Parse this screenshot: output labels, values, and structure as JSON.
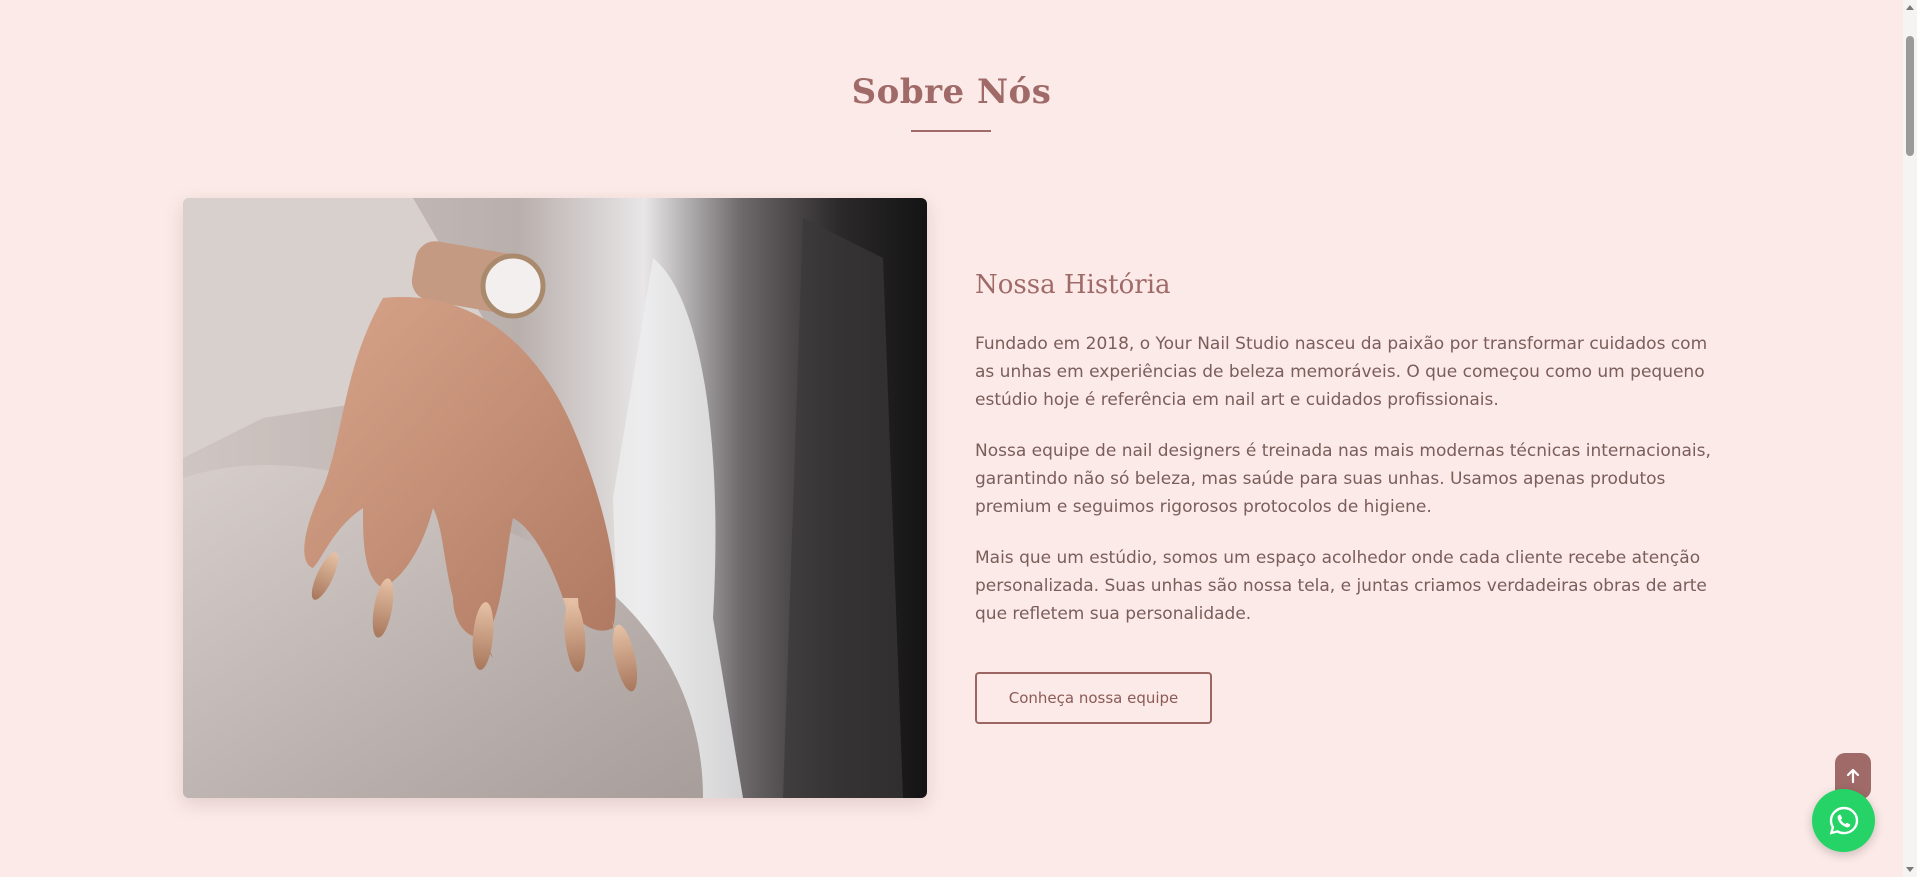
{
  "section": {
    "title": "Sobre Nós"
  },
  "photo": {
    "description_icon": "hand-with-nails-photo"
  },
  "about": {
    "subheading": "Nossa História",
    "paragraphs": [
      "Fundado em 2018, o Your Nail Studio nasceu da paixão por transformar cuidados com as unhas em experiências de beleza memoráveis. O que começou como um pequeno estúdio hoje é referência em nail art e cuidados profissionais.",
      "Nossa equipe de nail designers é treinada nas mais modernas técnicas internacionais, garantindo não só beleza, mas saúde para suas unhas. Usamos apenas produtos premium e seguimos rigorosos protocolos de higiene.",
      "Mais que um estúdio, somos um espaço acolhedor onde cada cliente recebe atenção personalizada. Suas unhas são nossa tela, e juntas criamos verdadeiras obras de arte que refletem sua personalidade."
    ],
    "button_label": "Conheça nossa equipe"
  },
  "floating": {
    "scroll_top_icon": "arrow-up-icon",
    "whatsapp_icon": "whatsapp-icon"
  },
  "colors": {
    "background": "#fbeae7",
    "accent": "#a06a68",
    "body_text": "#7b5d5b",
    "whatsapp": "#25d366"
  }
}
